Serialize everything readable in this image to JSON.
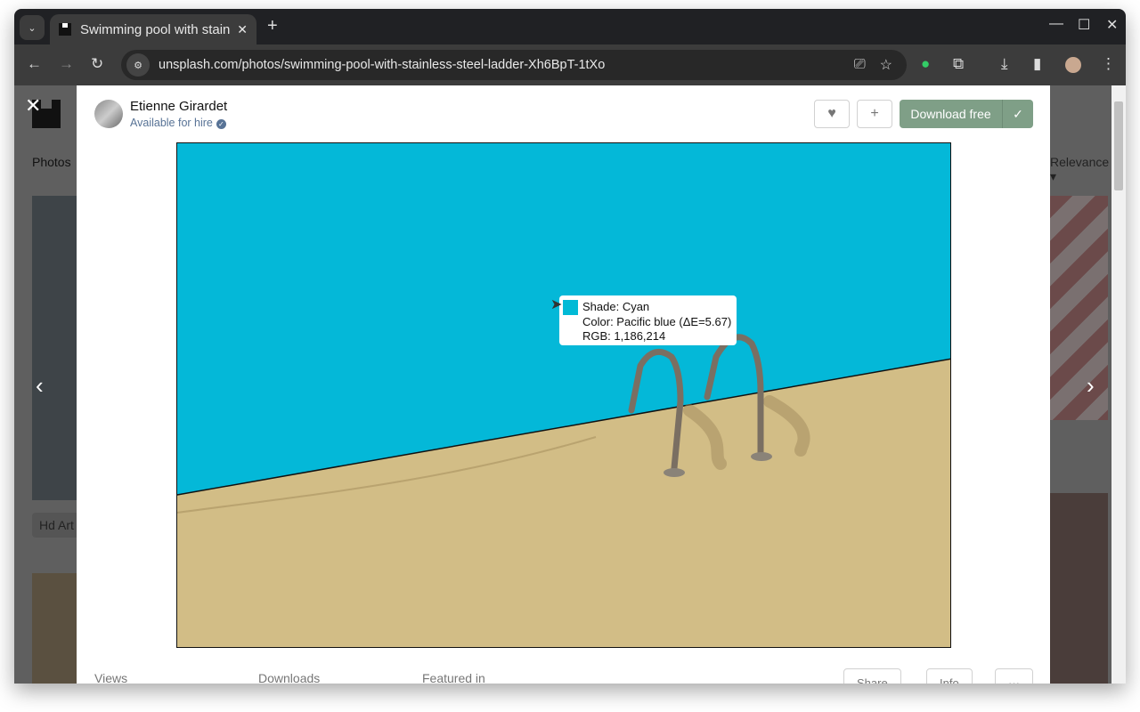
{
  "browser": {
    "tab_title": "Swimming pool with stainless steel ladder",
    "url": "unsplash.com/photos/swimming-pool-with-stainless-steel-ladder-Xh6BpT-1tXo"
  },
  "background": {
    "tab_label": "Photos",
    "tag": "Hd Art",
    "filter": "Relevance"
  },
  "author": {
    "name": "Etienne Girardet",
    "status": "Available for hire"
  },
  "actions": {
    "download": "Download free",
    "share": "Share",
    "info": "Info",
    "more": "···"
  },
  "stats": {
    "views": "Views",
    "downloads": "Downloads",
    "featured": "Featured in"
  },
  "tooltip": {
    "shade": "Shade: Cyan",
    "color": "Color: Pacific blue (ΔE=5.67)",
    "rgb": "RGB: 1,186,214",
    "swatch": "#01bad6"
  },
  "colors": {
    "pool": "#04b8d8",
    "sand": "#d2bd86",
    "download_button": "#7f9f87"
  }
}
